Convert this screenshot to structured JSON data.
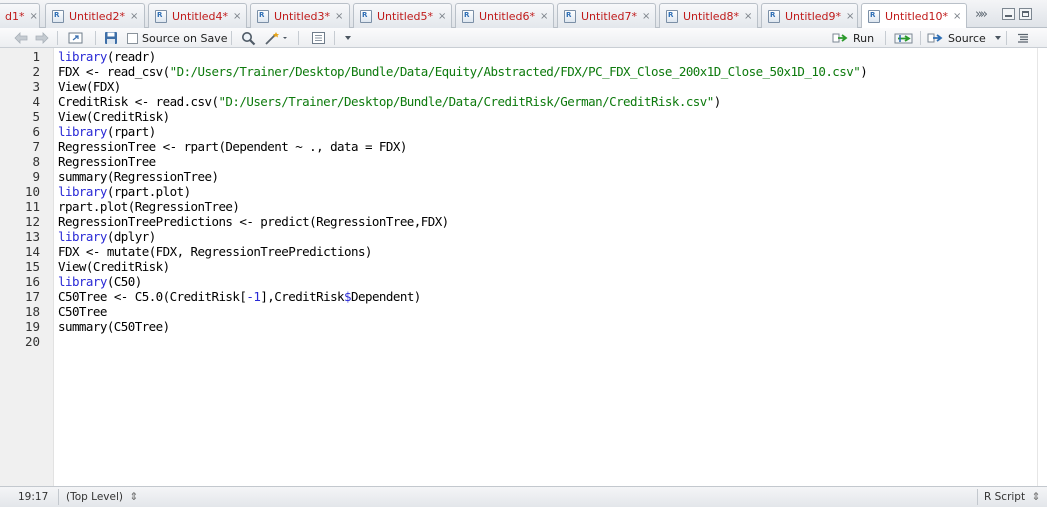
{
  "tabs": [
    {
      "label": "d1*",
      "active": false
    },
    {
      "label": "Untitled2*",
      "active": false
    },
    {
      "label": "Untitled4*",
      "active": false
    },
    {
      "label": "Untitled3*",
      "active": false
    },
    {
      "label": "Untitled5*",
      "active": false
    },
    {
      "label": "Untitled6*",
      "active": false
    },
    {
      "label": "Untitled7*",
      "active": false
    },
    {
      "label": "Untitled8*",
      "active": false
    },
    {
      "label": "Untitled9*",
      "active": false
    },
    {
      "label": "Untitled10*",
      "active": true
    }
  ],
  "toolbar": {
    "source_on_save": "Source on Save",
    "run": "Run",
    "source": "Source"
  },
  "code": {
    "line_numbers": [
      "1",
      "2",
      "3",
      "4",
      "5",
      "6",
      "7",
      "8",
      "9",
      "10",
      "11",
      "12",
      "13",
      "14",
      "15",
      "16",
      "17",
      "18",
      "19",
      "20"
    ],
    "lines": [
      [
        {
          "t": "library",
          "c": "kw"
        },
        {
          "t": "(readr)",
          "c": ""
        }
      ],
      [
        {
          "t": "FDX ",
          "c": ""
        },
        {
          "t": "<-",
          "c": "op"
        },
        {
          "t": " read_csv(",
          "c": ""
        },
        {
          "t": "\"D:/Users/Trainer/Desktop/Bundle/Data/Equity/Abstracted/FDX/PC_FDX_Close_200x1D_Close_50x1D_10.csv\"",
          "c": "str"
        },
        {
          "t": ")",
          "c": ""
        }
      ],
      [
        {
          "t": "View(FDX)",
          "c": ""
        }
      ],
      [
        {
          "t": "CreditRisk ",
          "c": ""
        },
        {
          "t": "<-",
          "c": "op"
        },
        {
          "t": " read.csv(",
          "c": ""
        },
        {
          "t": "\"D:/Users/Trainer/Desktop/Bundle/Data/CreditRisk/German/CreditRisk.csv\"",
          "c": "str"
        },
        {
          "t": ")",
          "c": ""
        }
      ],
      [
        {
          "t": "View(CreditRisk)",
          "c": ""
        }
      ],
      [
        {
          "t": "library",
          "c": "kw"
        },
        {
          "t": "(rpart)",
          "c": ""
        }
      ],
      [
        {
          "t": "RegressionTree ",
          "c": ""
        },
        {
          "t": "<-",
          "c": "op"
        },
        {
          "t": " rpart(Dependent ",
          "c": ""
        },
        {
          "t": "~",
          "c": "op"
        },
        {
          "t": " ., data ",
          "c": ""
        },
        {
          "t": "=",
          "c": "op"
        },
        {
          "t": " FDX)",
          "c": ""
        }
      ],
      [
        {
          "t": "RegressionTree",
          "c": ""
        }
      ],
      [
        {
          "t": "summary(RegressionTree)",
          "c": ""
        }
      ],
      [
        {
          "t": "library",
          "c": "kw"
        },
        {
          "t": "(rpart.plot)",
          "c": ""
        }
      ],
      [
        {
          "t": "rpart.plot(RegressionTree)",
          "c": ""
        }
      ],
      [
        {
          "t": "RegressionTreePredictions ",
          "c": ""
        },
        {
          "t": "<-",
          "c": "op"
        },
        {
          "t": " predict(RegressionTree,FDX)",
          "c": ""
        }
      ],
      [
        {
          "t": "library",
          "c": "kw"
        },
        {
          "t": "(dplyr)",
          "c": ""
        }
      ],
      [
        {
          "t": "FDX ",
          "c": ""
        },
        {
          "t": "<-",
          "c": "op"
        },
        {
          "t": " mutate(FDX, RegressionTreePredictions)",
          "c": ""
        }
      ],
      [
        {
          "t": "View(CreditRisk)",
          "c": ""
        }
      ],
      [
        {
          "t": "library",
          "c": "kw"
        },
        {
          "t": "(C50)",
          "c": ""
        }
      ],
      [
        {
          "t": "C50Tree ",
          "c": ""
        },
        {
          "t": "<-",
          "c": "op"
        },
        {
          "t": " C5.0(CreditRisk[",
          "c": ""
        },
        {
          "t": "-1",
          "c": "sym"
        },
        {
          "t": "],CreditRisk",
          "c": ""
        },
        {
          "t": "$",
          "c": "sym"
        },
        {
          "t": "Dependent)",
          "c": ""
        }
      ],
      [
        {
          "t": "C50Tree",
          "c": ""
        }
      ],
      [
        {
          "t": "summary(C50Tree)",
          "c": ""
        }
      ],
      [
        {
          "t": "",
          "c": ""
        }
      ]
    ]
  },
  "status": {
    "position": "19:17",
    "scope": "(Top Level)",
    "file_type": "R Script"
  },
  "colors": {
    "keyword": "#2a2ad6",
    "string": "#0d7a0d",
    "tab_label": "#c01b1b"
  }
}
